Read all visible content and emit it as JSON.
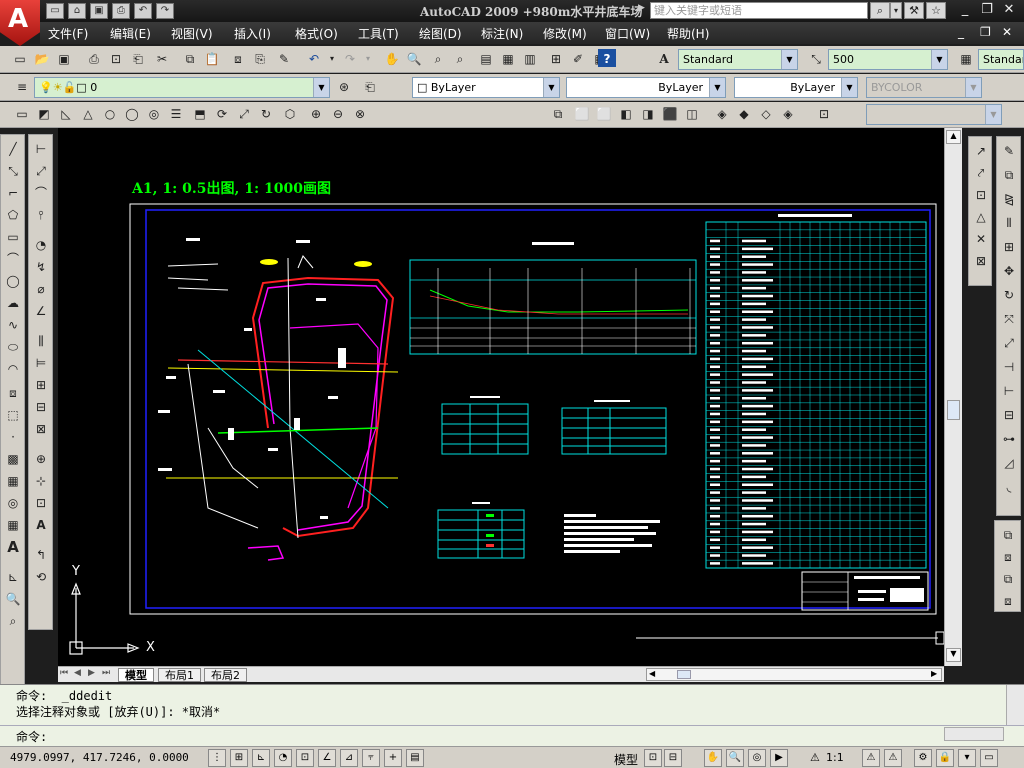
{
  "title_bar": {
    "app_logo_letter": "A",
    "title": "AutoCAD 2009  +980m水平井底车场",
    "search_placeholder": "键入关键字或短语"
  },
  "menu": [
    "文件(F)",
    "编辑(E)",
    "视图(V)",
    "插入(I)",
    "格式(O)",
    "工具(T)",
    "绘图(D)",
    "标注(N)",
    "修改(M)",
    "窗口(W)",
    "帮助(H)"
  ],
  "styles_toolbar": {
    "text_style": "Standard",
    "dim_scale": "500",
    "table_style": "Standar"
  },
  "layers_toolbar": {
    "layer_value": "0",
    "color": "ByLayer",
    "linetype": "ByLayer",
    "lineweight": "ByLayer",
    "plot_style": "BYCOLOR"
  },
  "drawing": {
    "heading": "A1, 1: 0.5出图, 1: 1000画图",
    "ucs_x": "X",
    "ucs_y": "Y",
    "colors": {
      "background": "#000000",
      "heading": "#00ff00",
      "border_blue": "#1c1cff",
      "cyan": "#00e0e0",
      "magenta": "#ff00ff",
      "yellow": "#ffff00",
      "green": "#00ff00",
      "red": "#ff3030"
    }
  },
  "layout_tabs": [
    "模型",
    "布局1",
    "布局2"
  ],
  "command": {
    "line1": "命令:  _ddedit",
    "line2": "选择注释对象或 [放弃(U)]: *取消*",
    "prompt": "命令:"
  },
  "status": {
    "coords": "4979.0997, 417.7246, 0.0000",
    "model_label": "模型",
    "annotation_scale": "1:1"
  }
}
